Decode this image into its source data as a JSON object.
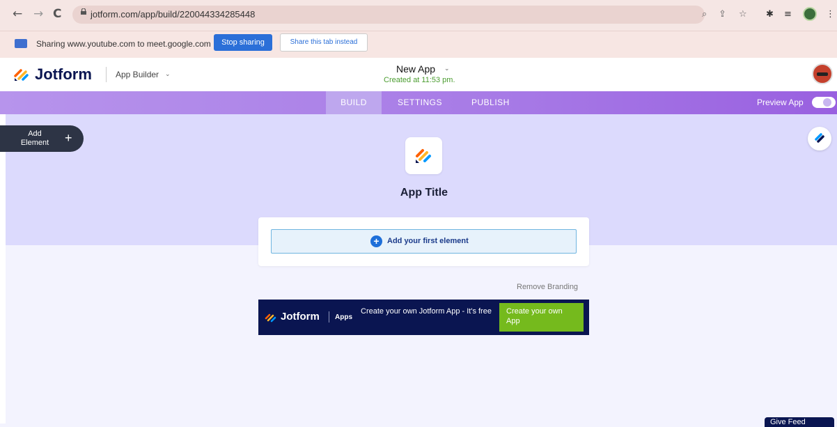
{
  "browser": {
    "back_icon": "arrow-left-icon",
    "forward_icon": "arrow-right-icon",
    "reload_icon": "reload-icon",
    "url": "jotform.com/app/build/220044334285448",
    "icons": [
      "zoom-icon",
      "share-icon",
      "star-icon",
      "extensions-icon",
      "reading-list-icon",
      "profile-icon",
      "kebab-menu-icon"
    ]
  },
  "sharing_bar": {
    "text": "Sharing www.youtube.com to meet.google.com",
    "stop_label": "Stop sharing",
    "share_tab_label": "Share this tab instead"
  },
  "header": {
    "logo_text": "Jotform",
    "builder_label": "App Builder",
    "app_name": "New App",
    "created": "Created at 11:53 pm."
  },
  "tabs": [
    {
      "label": "BUILD",
      "active": true
    },
    {
      "label": "SETTINGS",
      "active": false
    },
    {
      "label": "PUBLISH",
      "active": false
    }
  ],
  "preview_label": "Preview App",
  "preview_on": false,
  "canvas": {
    "add_element_label": "Add Element",
    "app_title": "App Title",
    "add_first_label": "Add your first element",
    "remove_branding": "Remove Branding"
  },
  "banner": {
    "logo": "Jotform",
    "apps": "Apps",
    "text": "Create your own Jotform App - It's free",
    "cta": "Create your own App"
  },
  "feedback_label": "Give Feed",
  "colors": {
    "brand_navy": "#0a1551",
    "accent_purple": "#a77ae6",
    "cta_green": "#75ba1d",
    "google_blue": "#2b6fd8"
  }
}
